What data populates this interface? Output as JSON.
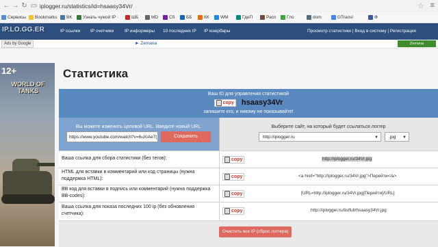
{
  "browser": {
    "url": "iplogger.ru/statistics/id=hsaasy34Vr/",
    "bookmarks": [
      {
        "label": "Сервисы",
        "color": "#5b8bd6"
      },
      {
        "label": "Bookmarks",
        "color": "#f2c230"
      },
      {
        "label": "ВК",
        "color": "#4a76a8"
      },
      {
        "label": "Узнать чужой IP ·",
        "color": "#2e7d32"
      },
      {
        "label": "ШБ",
        "color": "#c62828"
      },
      {
        "label": "MD",
        "color": "#666"
      },
      {
        "label": "Сб",
        "color": "#7b1fa2"
      },
      {
        "label": "ББ",
        "color": "#1565c0"
      },
      {
        "label": "КК",
        "color": "#ef6c00"
      },
      {
        "label": "WM",
        "color": "#1e88e5"
      },
      {
        "label": "ГдеП",
        "color": "#00897b"
      },
      {
        "label": "Расп",
        "color": "#6d4c41"
      },
      {
        "label": "Гло",
        "color": "#43a047"
      },
      {
        "label": "dom",
        "color": "#546e7a"
      },
      {
        "label": "GTransl",
        "color": "#4285f4"
      },
      {
        "label": "Ф",
        "color": "#3b5998"
      }
    ]
  },
  "site": {
    "logo": "IP.LO.GG.ER",
    "nav": [
      "IP ссылки",
      "IP счетчики",
      "IP информеры",
      "10 последних IP",
      "IP юзербары"
    ],
    "nav_right": "Просмотр статистики | Вход в систему | Регистрация",
    "ads_label": "Ads by Google",
    "ad_link": "► Zemana",
    "ad_button": "Zemana"
  },
  "left_ad": {
    "age": "12+",
    "title": "WORLD OF TANKS"
  },
  "page": {
    "title": "Статистика",
    "header_line1": "Ваш ID для управления статистикой",
    "copy_label": "copy",
    "id_value": "hsaasy34Vr",
    "header_line3": "запишите его, и никому не показывайте!",
    "change_url_text": "Вы можете изменить целевой URL. Введите новый URL:",
    "url_value": "https://www.youtube.com/watch?v=6uXiAe7(",
    "save_button": "Сохранить",
    "choose_site_text": "Выберите сайт, на который будет ссылаться логгер",
    "domain_select": "http://iplogger.ru",
    "ext_select": ".jpg",
    "rows": [
      {
        "label": "Ваша ссылка для сбора статистики (без тегов):",
        "value": "http://iplogger.ru/34Vr.jpg"
      },
      {
        "label": "HTML для вставки в комментарий или код страницы (нужна поддержка HTML):",
        "value": "<a href=\"http://iplogger.ru/34Vr.jpg\">Перейти</a>"
      },
      {
        "label": "BB код для вставки в подпись или комментарий (нужна поддержка BB-codes):",
        "value": "[URL=http://iplogger.ru/34Vr.jpg]Перейти[/URL]"
      },
      {
        "label": "Ваша ссылка для показа последних 100 ip (без обновления счетчика):",
        "value": "http://iplogger.ru/listfull/hsaasy34Vr.jpg"
      }
    ],
    "reset_button": "Очистить все IP (сброс логгера)"
  }
}
